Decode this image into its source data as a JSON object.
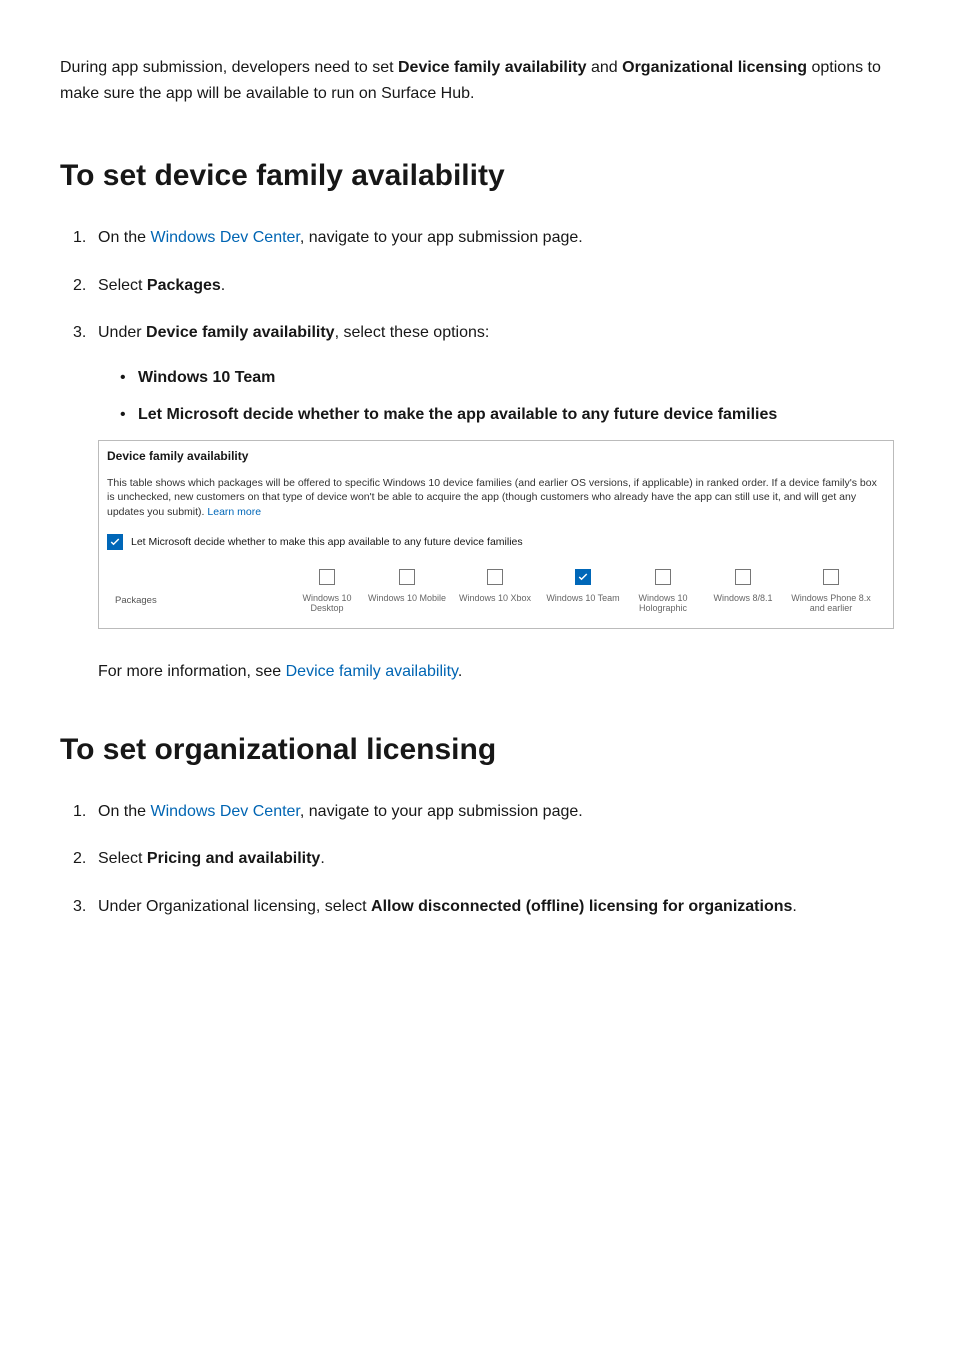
{
  "intro": {
    "part1": "During app submission, developers need to set ",
    "bold1": "Device family availability",
    "part2": " and ",
    "bold2": "Organizational licensing",
    "part3": " options to make sure the app will be available to run on Surface Hub."
  },
  "section1": {
    "heading": "To set device family availability",
    "step1": {
      "prefix": "On the ",
      "link": "Windows Dev Center",
      "suffix": ", navigate to your app submission page."
    },
    "step2": {
      "prefix": "Select ",
      "bold": "Packages",
      "suffix": "."
    },
    "step3": {
      "prefix": "Under ",
      "bold": "Device family availability",
      "suffix": ", select these options:",
      "bullet1": "Windows 10 Team",
      "bullet2": "Let Microsoft decide whether to make the app available to any future device families"
    },
    "screenshot": {
      "title": "Device family availability",
      "desc_part1": "This table shows which packages will be offered to specific Windows 10 device families (and earlier OS versions, if applicable) in ranked order. If a device family's box is unchecked, new customers on that type of device won't be able to acquire the app (though customers who already have the app can still use it, and will get any updates you submit). ",
      "desc_link": "Learn more",
      "checkbox_label": "Let Microsoft decide whether to make this app available to any future device families",
      "packages_label": "Packages",
      "devices": {
        "d1": "Windows 10 Desktop",
        "d2": "Windows 10 Mobile",
        "d3": "Windows 10 Xbox",
        "d4": "Windows 10 Team",
        "d5": "Windows 10 Holographic",
        "d6": "Windows 8/8.1",
        "d7": "Windows Phone 8.x and earlier"
      }
    },
    "followup": {
      "prefix": "For more information, see ",
      "link": "Device family availability",
      "suffix": "."
    }
  },
  "section2": {
    "heading": "To set organizational licensing",
    "step1": {
      "prefix": "On the ",
      "link": "Windows Dev Center",
      "suffix": ", navigate to your app submission page."
    },
    "step2": {
      "prefix": "Select ",
      "bold": "Pricing and availability",
      "suffix": "."
    },
    "step3": {
      "prefix": "Under Organizational licensing, select ",
      "bold": "Allow disconnected (offline) licensing for organizations",
      "suffix": "."
    }
  }
}
